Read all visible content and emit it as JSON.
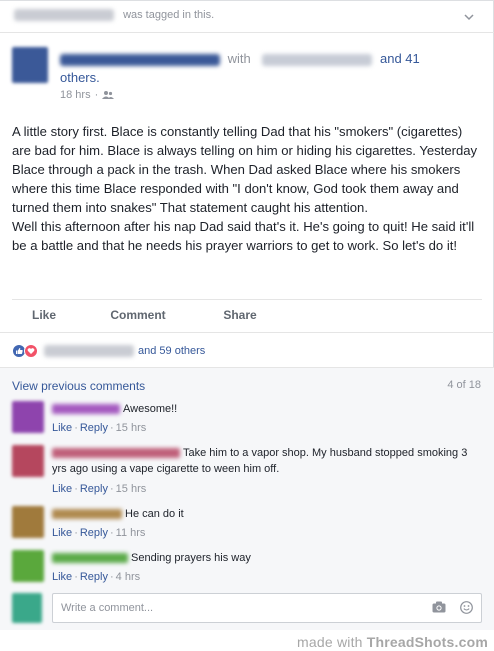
{
  "header": {
    "tagged_text": "was tagged in this."
  },
  "author": {
    "with_text": "with",
    "and_text": "and 41",
    "others_text": "others.",
    "time": "18 hrs"
  },
  "post": {
    "text": "A little story first. Blace is constantly telling Dad that his \"smokers\" (cigarettes) are bad for him. Blace is always telling on him or hiding his cigarettes. Yesterday Blace through a pack in the trash. When Dad asked Blace where his smokers where this time Blace responded with \"I don't know, God took them away and turned them into snakes\" That statement caught his attention.\nWell this afternoon after his nap Dad said that's it. He's going to quit! He said it'll be a battle and that he needs his prayer warriors to get to work. So let's do it!"
  },
  "actions": {
    "like": "Like",
    "comment": "Comment",
    "share": "Share"
  },
  "reactions": {
    "others": "and 59 others"
  },
  "comments_section": {
    "view_previous": "View previous comments",
    "count": "4 of 18",
    "items": [
      {
        "text": "Awesome!!",
        "time": "15 hrs",
        "color": "#8e44ad",
        "name_color": "#a55bc0"
      },
      {
        "text": "Take him to a vapor shop. My husband stopped smoking 3 yrs ago using a vape cigarette to ween him off.",
        "time": "15 hrs",
        "color": "#b5475e",
        "name_color": "#c0607a"
      },
      {
        "text": "He can do it",
        "time": "11 hrs",
        "color": "#a07a3c",
        "name_color": "#b08a50"
      },
      {
        "text": "Sending prayers his way",
        "time": "4 hrs",
        "color": "#5aa83c",
        "name_color": "#5cab4a"
      }
    ],
    "like_label": "Like",
    "reply_label": "Reply"
  },
  "composer": {
    "placeholder": "Write a comment..."
  },
  "watermark": {
    "prefix": "made with",
    "brand": "ThreadShots.com"
  }
}
